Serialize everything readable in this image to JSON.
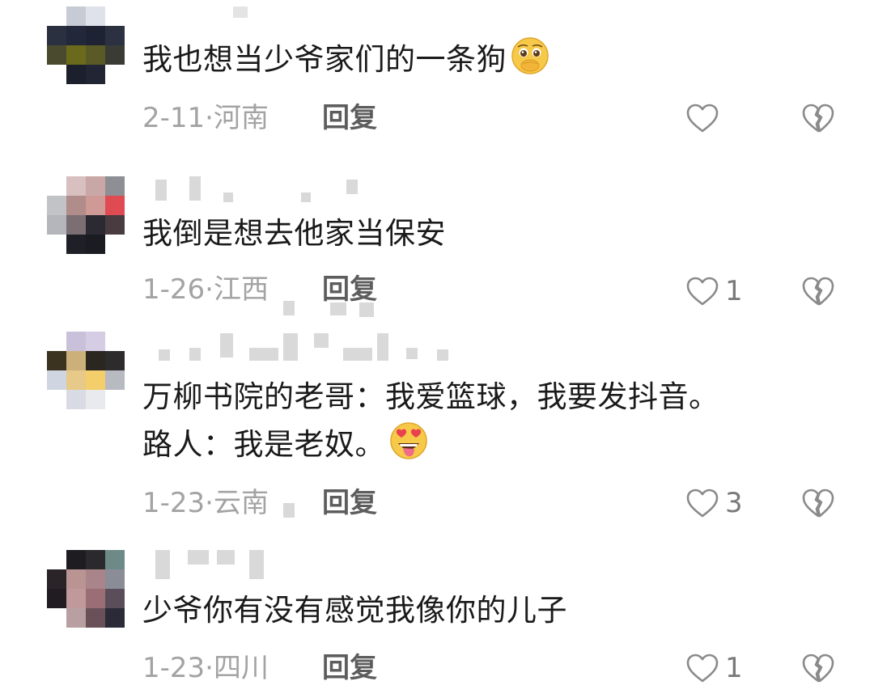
{
  "comments": [
    {
      "text": "我也想当少爷家们的一条狗",
      "emoji": "pleading-face-covering-mouth",
      "date": "2-11",
      "location": "河南",
      "reply_label": "回复",
      "likes": ""
    },
    {
      "text": "我倒是想去他家当保安",
      "date": "1-26",
      "location": "江西",
      "reply_label": "回复",
      "likes": "1"
    },
    {
      "text_line1": "万柳书院的老哥：我爱篮球，我要发抖音。",
      "text_line2": "路人：我是老奴。",
      "emoji": "heart-eyes-tongue-face",
      "date": "1-23",
      "location": "云南",
      "reply_label": "回复",
      "likes": "3"
    },
    {
      "text": "少爷你有没有感觉我像你的儿子",
      "date": "1-23",
      "location": "四川",
      "reply_label": "回复",
      "likes": "1"
    }
  ],
  "separator": "·",
  "colors": {
    "text": "#1a1a1a",
    "meta": "#a3a3a3",
    "reply": "#5d5d5d",
    "icon_stroke": "#8a8a8a"
  }
}
